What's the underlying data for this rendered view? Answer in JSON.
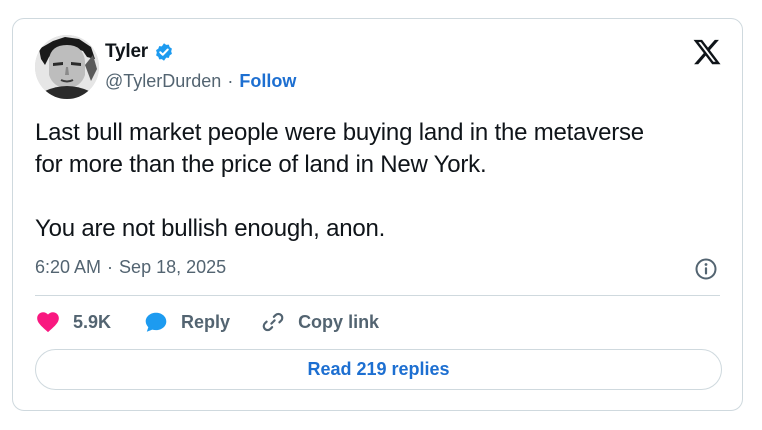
{
  "author": {
    "name": "Tyler",
    "handle": "@TylerDurden",
    "separator": "·",
    "follow_label": "Follow",
    "verified_icon": "verified-badge-icon",
    "avatar": "profile-avatar"
  },
  "tweet": {
    "text": "Last bull market people were buying land in the metaverse\nfor more than the price of land in New York.\n\nYou are not bullish enough, anon.",
    "time": "6:20 AM",
    "date_separator": "·",
    "date": "Sep 18, 2025"
  },
  "actions": {
    "likes": "5.9K",
    "reply_label": "Reply",
    "copy_link_label": "Copy link"
  },
  "read_replies_label": "Read 219 replies",
  "colors": {
    "accent": "#1d6fd1",
    "like": "#f91880",
    "verified": "#1d9bf0",
    "muted": "#536471",
    "border": "#cfd9de"
  },
  "icons": [
    "x-logo-icon",
    "info-icon",
    "heart-icon",
    "reply-bubble-icon",
    "link-icon",
    "verified-badge-icon"
  ]
}
